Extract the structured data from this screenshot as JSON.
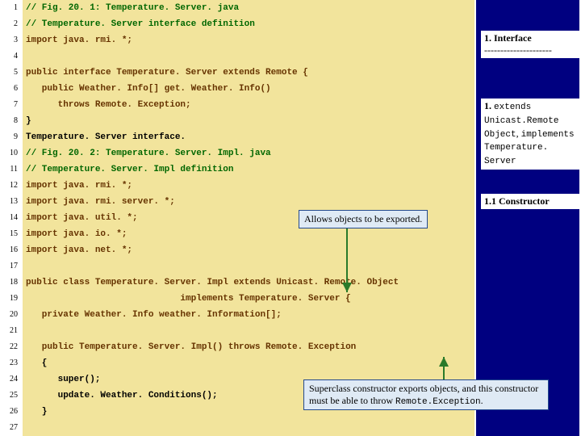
{
  "code": {
    "lines": [
      {
        "n": "1",
        "text": "// Fig. 20. 1: Temperature. Server. java",
        "cls": "comment"
      },
      {
        "n": "2",
        "text": "// Temperature. Server interface definition",
        "cls": "comment"
      },
      {
        "n": "3",
        "text": "import java. rmi. *;",
        "cls": "keyword"
      },
      {
        "n": "4",
        "text": "",
        "cls": ""
      },
      {
        "n": "5",
        "text": "public interface Temperature. Server extends Remote {",
        "cls": "keyword"
      },
      {
        "n": "6",
        "text": "   public Weather. Info[] get. Weather. Info()",
        "cls": "keyword"
      },
      {
        "n": "7",
        "text": "      throws Remote. Exception;",
        "cls": "keyword"
      },
      {
        "n": "8",
        "text": "}",
        "cls": ""
      },
      {
        "n": "9",
        "text": "Temperature. Server interface.",
        "cls": ""
      },
      {
        "n": "10",
        "text": "// Fig. 20. 2: Temperature. Server. Impl. java",
        "cls": "comment"
      },
      {
        "n": "11",
        "text": "// Temperature. Server. Impl definition",
        "cls": "comment"
      },
      {
        "n": "12",
        "text": "import java. rmi. *;",
        "cls": "keyword"
      },
      {
        "n": "13",
        "text": "import java. rmi. server. *;",
        "cls": "keyword"
      },
      {
        "n": "14",
        "text": "import java. util. *;",
        "cls": "keyword"
      },
      {
        "n": "15",
        "text": "import java. io. *;",
        "cls": "keyword"
      },
      {
        "n": "16",
        "text": "import java. net. *;",
        "cls": "keyword"
      },
      {
        "n": "17",
        "text": "",
        "cls": ""
      },
      {
        "n": "18",
        "text": "public class Temperature. Server. Impl extends Unicast. Remote. Object",
        "cls": "keyword"
      },
      {
        "n": "19",
        "text": "                             implements Temperature. Server {",
        "cls": "keyword"
      },
      {
        "n": "20",
        "text": "   private Weather. Info weather. Information[];",
        "cls": "keyword"
      },
      {
        "n": "21",
        "text": "",
        "cls": ""
      },
      {
        "n": "22",
        "text": "   public Temperature. Server. Impl() throws Remote. Exception",
        "cls": "keyword"
      },
      {
        "n": "23",
        "text": "   {",
        "cls": ""
      },
      {
        "n": "24",
        "text": "      super();",
        "cls": ""
      },
      {
        "n": "25",
        "text": "      update. Weather. Conditions();",
        "cls": ""
      },
      {
        "n": "26",
        "text": "   }",
        "cls": ""
      },
      {
        "n": "27",
        "text": "",
        "cls": ""
      }
    ]
  },
  "side": {
    "box1_l1": "1. Interface",
    "box1_l2": "---------------------",
    "box2_l1": "1. ",
    "box2_code1": "extends Unicast.Remote Object",
    "box2_mid": ", ",
    "box2_code2": "implements Temperature. Server",
    "box3": "1.1 Constructor"
  },
  "callouts": {
    "c1": "Allows objects to be exported.",
    "c2_l1": "Superclass constructor exports objects, and this constructor must be able to throw ",
    "c2_code": "Remote.Exception",
    "c2_end": "."
  }
}
